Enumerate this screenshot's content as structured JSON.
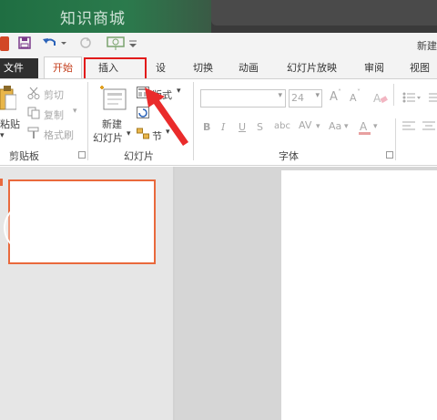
{
  "watermark": {
    "text": "知识商城"
  },
  "window": {
    "title_fragment": "新建"
  },
  "qat": {
    "icons": [
      "app-icon",
      "save-icon",
      "undo-icon",
      "redo-icon",
      "present-icon",
      "customize-icon"
    ]
  },
  "tabs": [
    {
      "label": "文件"
    },
    {
      "label": "开始"
    },
    {
      "label": "插入"
    },
    {
      "label": "设计"
    },
    {
      "label": "切换"
    },
    {
      "label": "动画"
    },
    {
      "label": "幻灯片放映"
    },
    {
      "label": "审阅"
    },
    {
      "label": "视图"
    }
  ],
  "clipboard": {
    "paste_label": "粘贴",
    "cut_label": "剪切",
    "copy_label": "复制",
    "format_painter_label": "格式刷",
    "group_label": "剪贴板"
  },
  "slides_group": {
    "new_slide_line1": "新建",
    "new_slide_line2": "幻灯片",
    "layout_label": "版式",
    "section_label": "节",
    "group_label": "幻灯片"
  },
  "font_group": {
    "font_name": "",
    "font_size": "24",
    "grow_label": "A",
    "shrink_label": "A",
    "bold": "B",
    "italic": "I",
    "underline": "U",
    "strike": "S",
    "shadow": "abc",
    "spacing": "AV",
    "case": "Aa",
    "group_label": "字体"
  },
  "colors": {
    "accent": "#c43e1c",
    "highlight_box": "#e21a1a",
    "thumbnail_border": "#e9693c",
    "banner_green": "#217346"
  }
}
